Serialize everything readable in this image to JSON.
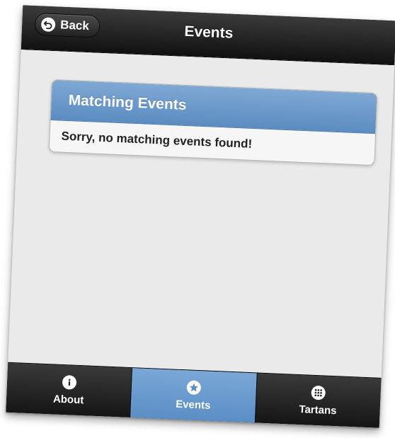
{
  "header": {
    "back_label": "Back",
    "title": "Events"
  },
  "results": {
    "heading": "Matching Events",
    "message": "Sorry, no matching events found!"
  },
  "tabs": [
    {
      "label": "About",
      "icon": "info-icon",
      "active": false
    },
    {
      "label": "Events",
      "icon": "star-icon",
      "active": true
    },
    {
      "label": "Tartans",
      "icon": "grid-icon",
      "active": false
    }
  ],
  "colors": {
    "accent": "#6b9bcf",
    "bar": "#1f1f1f",
    "background": "#eaeaea"
  }
}
